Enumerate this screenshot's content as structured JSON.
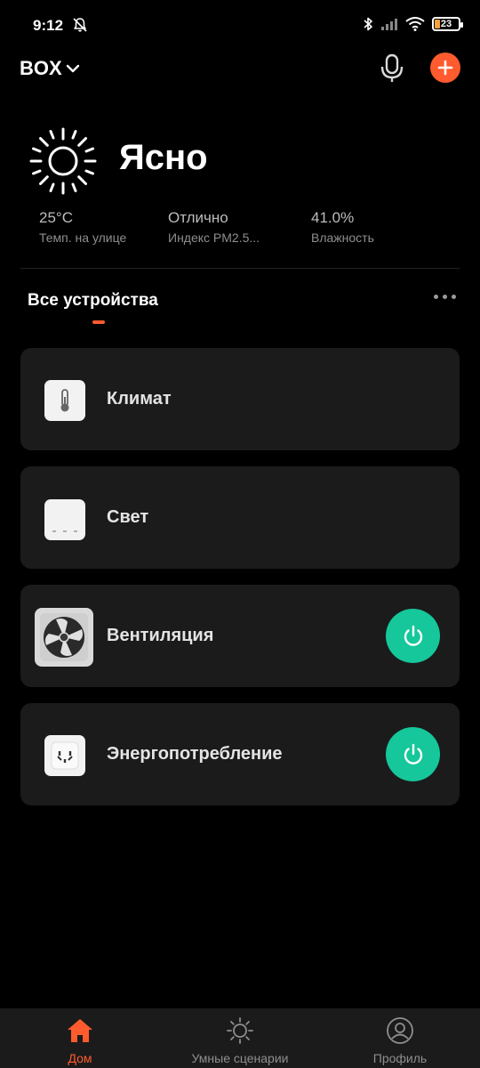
{
  "status_bar": {
    "time": "9:12",
    "battery": "23"
  },
  "header": {
    "home_name": "BOX",
    "icons": [
      "chevron-down-icon",
      "microphone-icon",
      "add-icon"
    ],
    "accent_color": "#ff5b2e"
  },
  "weather": {
    "condition": "Ясно",
    "icon": "sun-icon",
    "metrics": [
      {
        "value": "25°C",
        "label": "Темп. на улице"
      },
      {
        "value": "Отлично",
        "label": "Индекс PM2.5..."
      },
      {
        "value": "41.0%",
        "label": "Влажность"
      }
    ]
  },
  "section": {
    "title": "Все устройства"
  },
  "devices": [
    {
      "label": "Климат",
      "icon": "thermometer-icon",
      "has_power": false
    },
    {
      "label": "Свет",
      "icon": "light-switch-icon",
      "has_power": false
    },
    {
      "label": "Вентиляция",
      "icon": "fan-icon",
      "has_power": true
    },
    {
      "label": "Энергопотребление",
      "icon": "power-socket-icon",
      "has_power": true
    }
  ],
  "power_color": "#15c79a",
  "bottom_nav": [
    {
      "label": "Дом",
      "icon": "home-icon",
      "active": true
    },
    {
      "label": "Умные сценарии",
      "icon": "sun-outline-icon",
      "active": false
    },
    {
      "label": "Профиль",
      "icon": "profile-icon",
      "active": false
    }
  ]
}
